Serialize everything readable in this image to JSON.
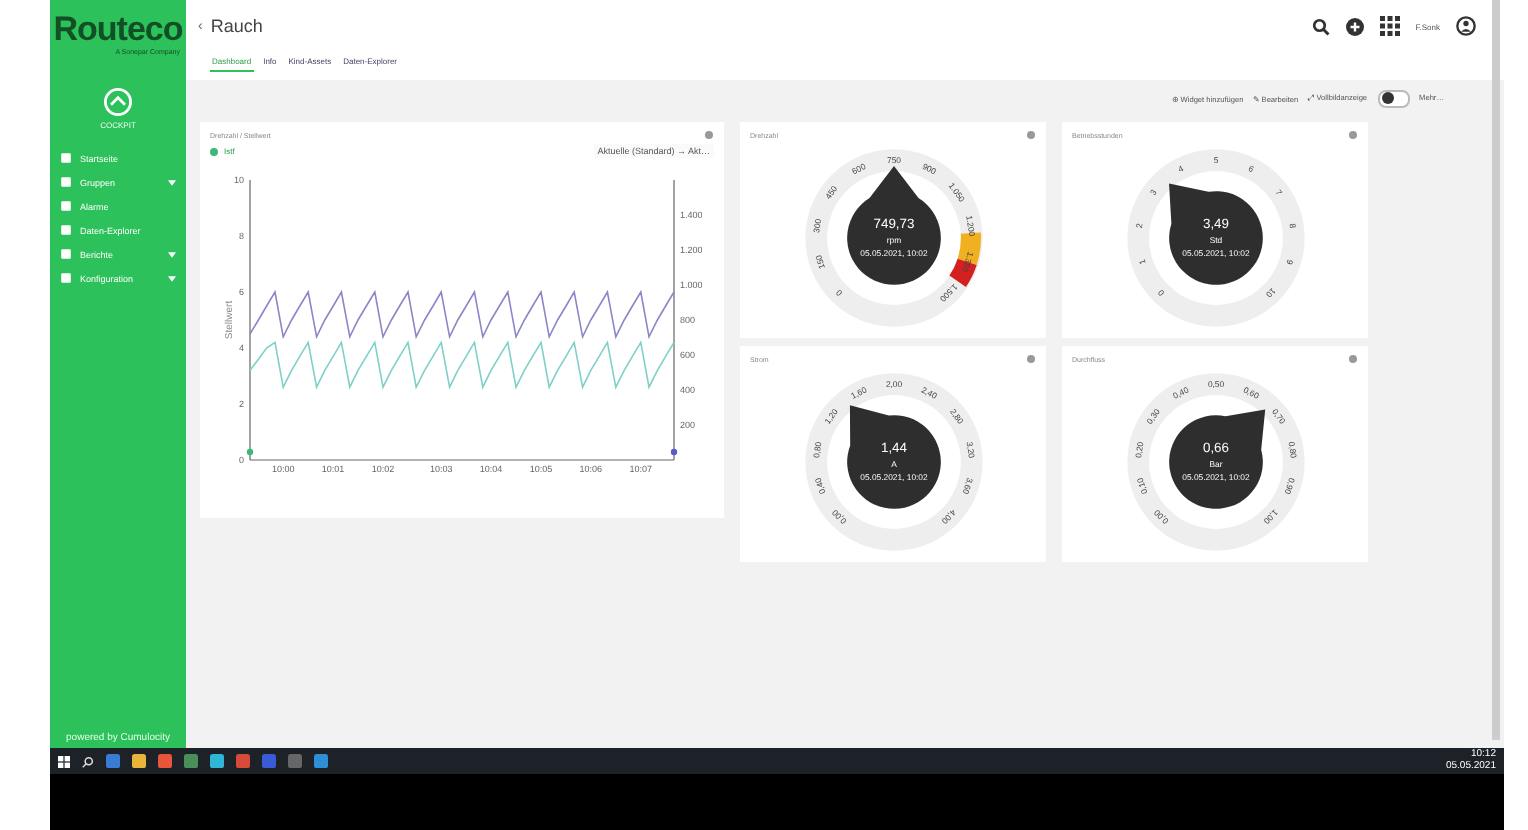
{
  "brand": {
    "logo": "Routeco",
    "tagline": "A Sonepar Company"
  },
  "sidebar": {
    "cockpit": "COCKPIT",
    "items": [
      {
        "label": "Startseite",
        "expandable": false
      },
      {
        "label": "Gruppen",
        "expandable": true
      },
      {
        "label": "Alarme",
        "expandable": false
      },
      {
        "label": "Daten-Explorer",
        "expandable": false
      },
      {
        "label": "Berichte",
        "expandable": true
      },
      {
        "label": "Konfiguration",
        "expandable": true
      }
    ],
    "footer": "powered by Cumulocity"
  },
  "header": {
    "back": "‹",
    "title": "Rauch",
    "user": "F.Sonk"
  },
  "tabs": [
    {
      "label": "Dashboard",
      "selected": true
    },
    {
      "label": "Info",
      "selected": false
    },
    {
      "label": "Kind-Assets",
      "selected": false
    },
    {
      "label": "Daten-Explorer",
      "selected": false
    }
  ],
  "toolbar": {
    "actions": [
      "⊕ Widget hinzufügen",
      "✎ Bearbeiten",
      "⤢ Vollbildanzeige"
    ],
    "fullscreen_on": false,
    "more": "Mehr…"
  },
  "chart_card": {
    "title": "Drehzahl / Stellwert",
    "legend": "Istf",
    "range": "Aktuelle (Standard) → Akt…",
    "chart_data": {
      "type": "line",
      "ylabel": "Stellwert",
      "categories": [
        null,
        null,
        null,
        null,
        "10:00",
        null,
        null,
        null,
        null,
        null,
        "10:01",
        null,
        null,
        null,
        null,
        null,
        "10:02",
        null,
        null,
        null,
        null,
        null,
        null,
        "10:03",
        null,
        null,
        null,
        null,
        null,
        "10:04",
        null,
        null,
        null,
        null,
        null,
        "10:05",
        null,
        null,
        null,
        null,
        null,
        "10:06",
        null,
        null,
        null,
        null,
        null,
        "10:07",
        null,
        null,
        null,
        null
      ],
      "ylim": [
        0,
        10
      ],
      "yticks": [
        0,
        2,
        4,
        6,
        8,
        10
      ],
      "series": [
        {
          "color": "#8a86c8",
          "values": [
            4.5,
            5.0,
            5.5,
            6.0,
            4.4,
            5.0,
            5.5,
            6.0,
            4.4,
            5.0,
            5.5,
            6.0,
            4.4,
            5.0,
            5.5,
            6.0,
            4.4,
            5.0,
            5.5,
            6.0,
            4.4,
            5.0,
            5.5,
            6.0,
            4.4,
            5.0,
            5.5,
            6.0,
            4.4,
            5.0,
            5.5,
            6.0,
            4.4,
            5.0,
            5.5,
            6.0,
            4.4,
            5.0,
            5.5,
            6.0,
            4.4,
            5.0,
            5.5,
            6.0,
            4.4,
            5.0,
            5.5,
            6.0,
            4.4,
            5.0,
            5.5,
            6.0
          ]
        },
        {
          "color": "#7fd0c8",
          "values": [
            3.2,
            3.6,
            4.0,
            4.2,
            2.6,
            3.2,
            3.7,
            4.2,
            2.6,
            3.2,
            3.7,
            4.2,
            2.6,
            3.2,
            3.7,
            4.2,
            2.6,
            3.2,
            3.7,
            4.2,
            2.6,
            3.2,
            3.7,
            4.2,
            2.6,
            3.2,
            3.7,
            4.2,
            2.6,
            3.2,
            3.7,
            4.2,
            2.6,
            3.2,
            3.7,
            4.2,
            2.6,
            3.2,
            3.7,
            4.2,
            2.6,
            3.2,
            3.7,
            4.2,
            2.6,
            3.2,
            3.7,
            4.2,
            2.6,
            3.2,
            3.7,
            4.2
          ]
        }
      ]
    },
    "right_axis": [
      "1.400",
      "1.200",
      "1.000",
      "800",
      "600",
      "400",
      "200"
    ]
  },
  "gauges": [
    {
      "title": "Drehzahl",
      "value": "749,73",
      "unit": "rpm",
      "time": "05.05.2021, 10:02",
      "warning_band": true,
      "ticks": [
        "0",
        "150",
        "300",
        "450",
        "600",
        "750",
        "900",
        "1.050",
        "1.200",
        "1.350",
        "1.500"
      ]
    },
    {
      "title": "Betriebsstunden",
      "value": "3,49",
      "unit": "Std",
      "time": "05.05.2021, 10:02",
      "warning_band": false,
      "ticks": [
        "0",
        "1",
        "2",
        "3",
        "4",
        "5",
        "6",
        "7",
        "8",
        "9",
        "10"
      ]
    },
    {
      "title": "Strom",
      "value": "1,44",
      "unit": "A",
      "time": "05.05.2021, 10:02",
      "warning_band": false,
      "ticks": [
        "0,00",
        "0,40",
        "0,80",
        "1,20",
        "1,60",
        "2,00",
        "2,40",
        "2,80",
        "3,20",
        "3,60",
        "4,00"
      ]
    },
    {
      "title": "Durchfluss",
      "value": "0,66",
      "unit": "Bar",
      "time": "05.05.2021, 10:02",
      "warning_band": false,
      "ticks": [
        "0,00",
        "0,10",
        "0,20",
        "0,30",
        "0,40",
        "0,50",
        "0,60",
        "0,70",
        "0,80",
        "0,90",
        "1,00"
      ]
    }
  ],
  "taskbar": {
    "apps": [
      {
        "color": "#3a7bd5"
      },
      {
        "color": "#e8b53a"
      },
      {
        "color": "#e8553a"
      },
      {
        "color": "#4a8f5a"
      },
      {
        "color": "#2fb6d6"
      },
      {
        "color": "#d64a3a"
      },
      {
        "color": "#3a5bd5"
      },
      {
        "color": "#666666"
      },
      {
        "color": "#2f8fd6"
      }
    ],
    "time": "10:12",
    "date": "05.05.2021"
  }
}
